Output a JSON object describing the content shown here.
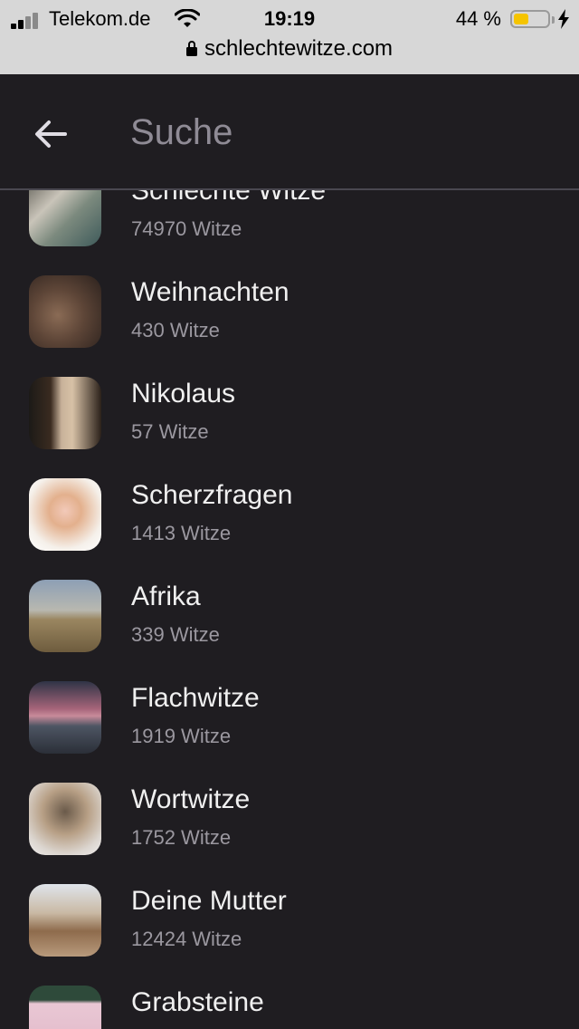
{
  "status_bar": {
    "carrier": "Telekom.de",
    "time": "19:19",
    "battery_percent": "44 %",
    "battery_level": 0.44,
    "url": "schlechtewitze.com"
  },
  "header": {
    "search_placeholder": "Suche"
  },
  "categories": [
    {
      "title": "Schlechte Witze",
      "count": "74970 Witze"
    },
    {
      "title": "Weihnachten",
      "count": "430 Witze"
    },
    {
      "title": "Nikolaus",
      "count": "57 Witze"
    },
    {
      "title": "Scherzfragen",
      "count": "1413 Witze"
    },
    {
      "title": "Afrika",
      "count": "339 Witze"
    },
    {
      "title": "Flachwitze",
      "count": "1919 Witze"
    },
    {
      "title": "Wortwitze",
      "count": "1752 Witze"
    },
    {
      "title": "Deine Mutter",
      "count": "12424 Witze"
    },
    {
      "title": "Grabsteine",
      "count": ""
    }
  ]
}
